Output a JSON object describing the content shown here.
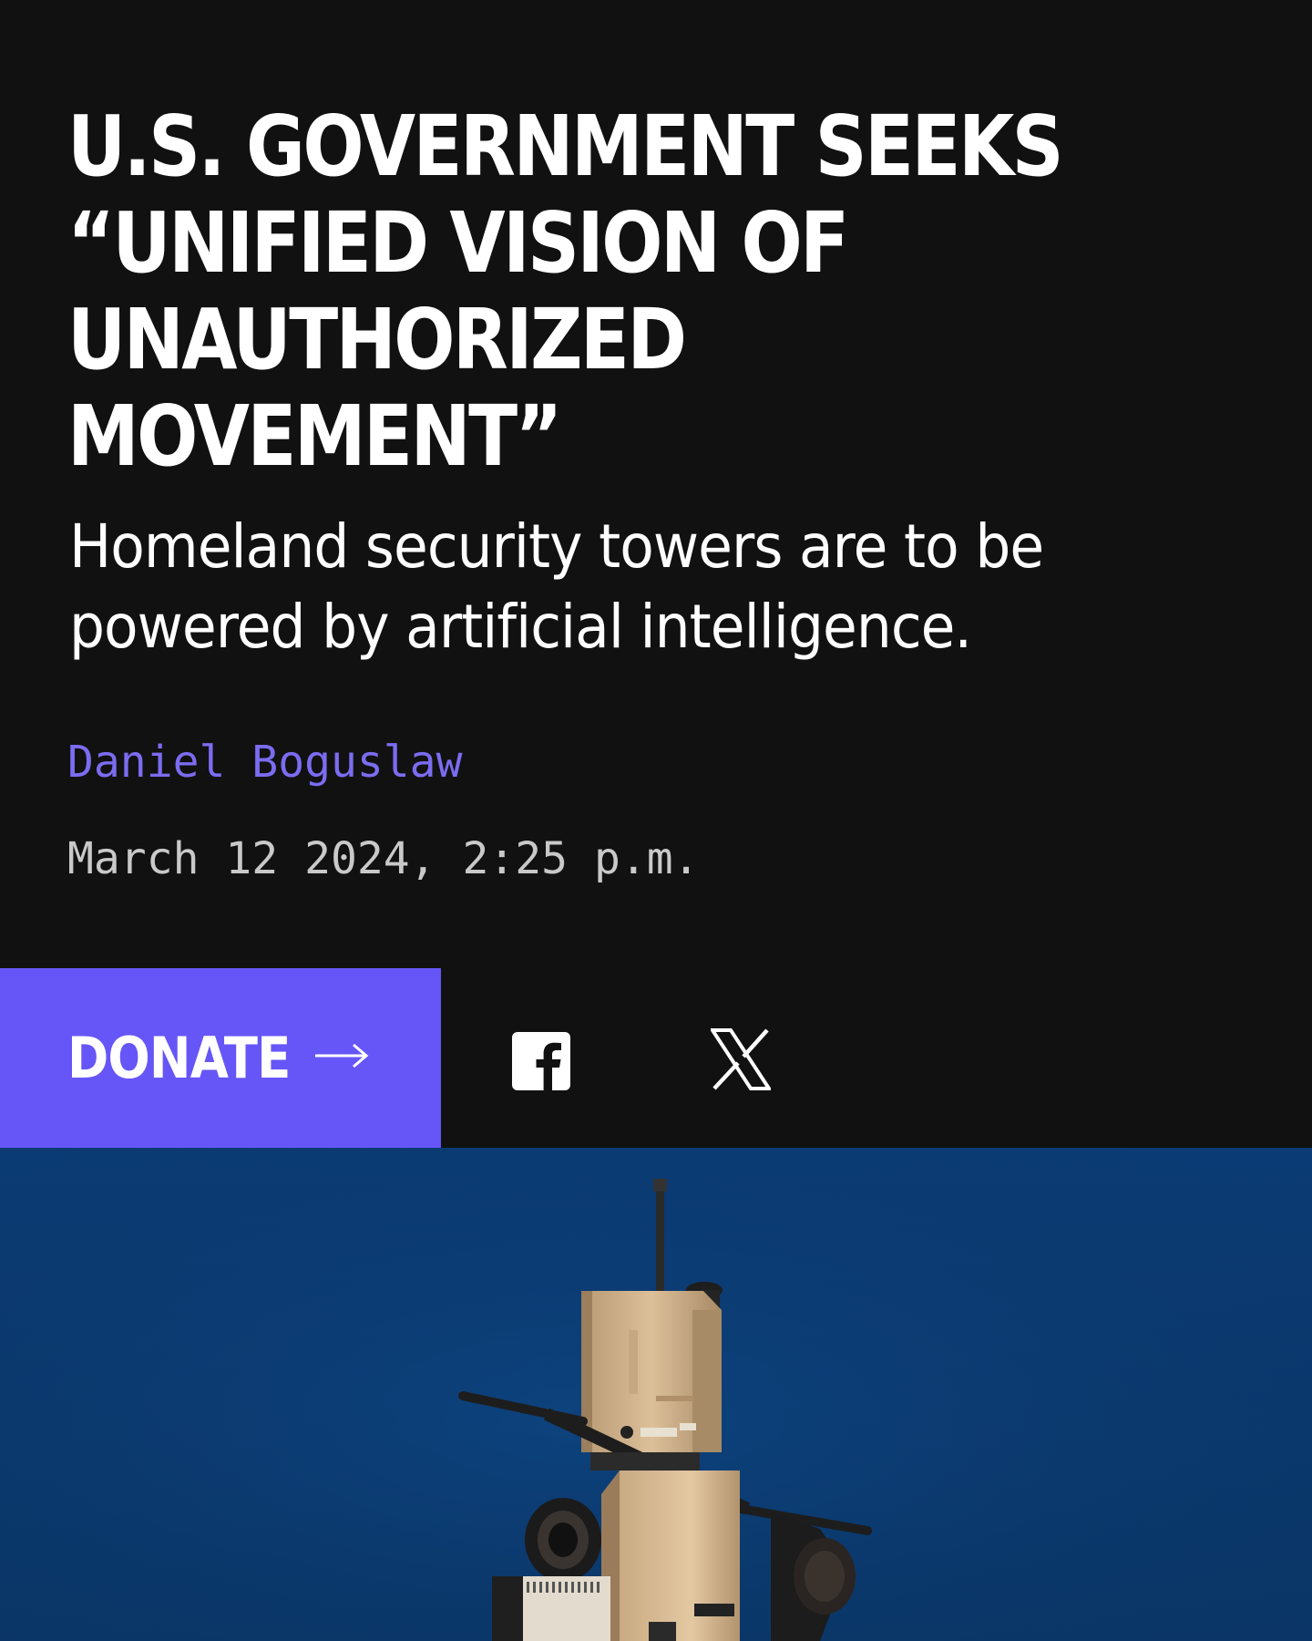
{
  "article": {
    "headline": "U.S. GOVERNMENT SEEKS “UNIFIED VISION OF UNAUTHORIZED MOVEMENT”",
    "subtitle": "Homeland security towers are to be powered by artificial intelligence.",
    "author": "Daniel Boguslaw",
    "timestamp": "March 12 2024, 2:25 p.m."
  },
  "actions": {
    "donate_label": "DONATE",
    "share_icons": [
      "facebook-icon",
      "x-icon"
    ]
  },
  "colors": {
    "background": "#111111",
    "accent": "#6656f7",
    "author_link": "#7b6cf0",
    "sky": "#0a3a72"
  }
}
